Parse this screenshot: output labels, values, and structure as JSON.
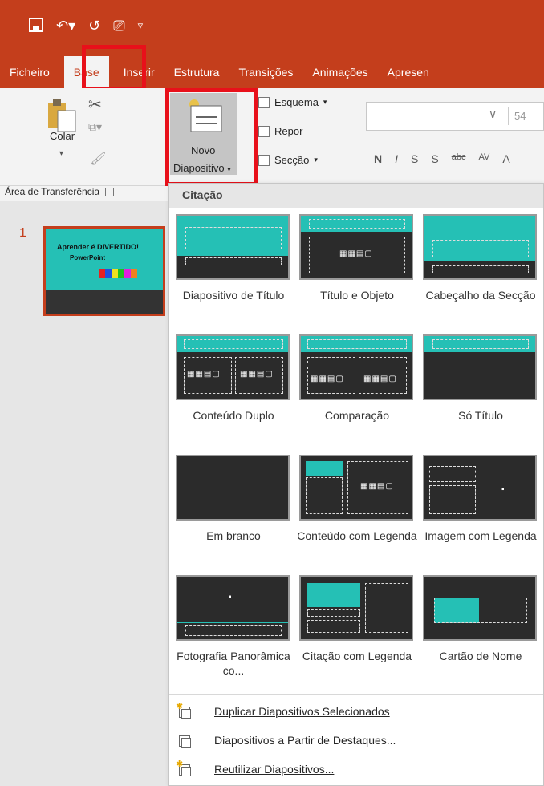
{
  "qat": {
    "save_icon": "save-icon",
    "undo_icon": "undo-icon",
    "redo_icon": "redo-icon",
    "present_icon": "present-icon",
    "customize_icon": "customize-icon"
  },
  "tabs": [
    {
      "label": "Ficheiro"
    },
    {
      "label": "Base"
    },
    {
      "label": "Inserir"
    },
    {
      "label": "Estrutura"
    },
    {
      "label": "Transições"
    },
    {
      "label": "Animações"
    },
    {
      "label": "Apresen"
    }
  ],
  "ribbon": {
    "paste_label": "Colar",
    "new_slide_line1": "Novo",
    "new_slide_line2": "Diapositivo",
    "layout_label": "Esquema",
    "reset_label": "Repor",
    "section_label": "Secção",
    "font_size": "54",
    "clipboard_group": "Área de Transferência",
    "format_buttons": [
      "N",
      "I",
      "S",
      "S",
      "abc",
      "AV",
      "A"
    ]
  },
  "slides_pane": {
    "slide_number": "1",
    "slide_title": "Aprender é DIVERTIDO!",
    "slide_subtitle": "PowerPoint"
  },
  "gallery": {
    "header": "Citação",
    "layouts": [
      {
        "label": "Diapositivo de Título"
      },
      {
        "label": "Título e Objeto"
      },
      {
        "label": "Cabeçalho da Secção"
      },
      {
        "label": "Conteúdo Duplo"
      },
      {
        "label": "Comparação"
      },
      {
        "label": "Só Título"
      },
      {
        "label": "Em branco"
      },
      {
        "label": "Conteúdo com Legenda"
      },
      {
        "label": "Imagem com Legenda"
      },
      {
        "label": "Fotografia Panorâmica co..."
      },
      {
        "label": "Citação com Legenda"
      },
      {
        "label": "Cartão de Nome"
      }
    ],
    "menu": [
      {
        "label": "Duplicar Diapositivos Selecionados"
      },
      {
        "label": "Diapositivos a Partir de Destaques..."
      },
      {
        "label": "Reutilizar Diapositivos..."
      }
    ]
  },
  "colors": {
    "accent": "#c43e1c",
    "teal": "#25c0b5",
    "highlight": "#e8101a"
  }
}
